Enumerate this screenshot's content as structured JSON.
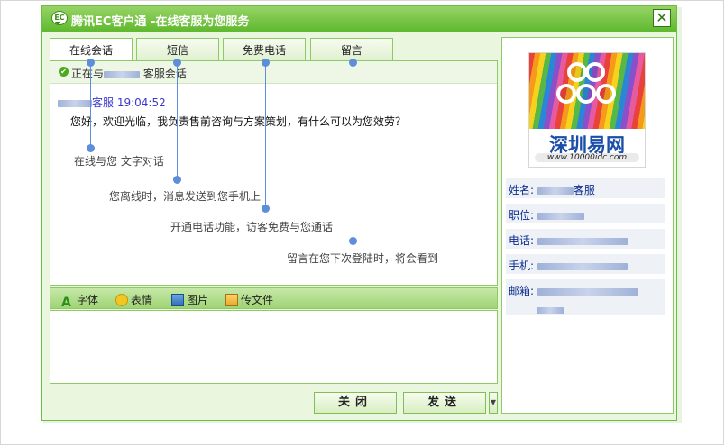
{
  "window": {
    "title": "腾讯EC客户通 -在线客服为您服务",
    "logo_text": "EC",
    "close_symbol": "✕"
  },
  "tabs": [
    {
      "label": "在线会话",
      "active": true
    },
    {
      "label": "短信",
      "active": false
    },
    {
      "label": "免费电话",
      "active": false
    },
    {
      "label": "留言",
      "active": false
    }
  ],
  "chat": {
    "status_prefix": "正在与",
    "status_suffix": "客服会话",
    "sender_suffix": "客服",
    "time": "19:04:52",
    "message": "您好，欢迎光临，我负责售前咨询与方案策划，有什么可以为您效劳？"
  },
  "annotations": {
    "chat": "在线与您 文字对话",
    "sms": "您离线时，消息发送到您手机上",
    "phone": "开通电话功能，访客免费与您通话",
    "message": "留言在您下次登陆时，将会看到"
  },
  "toolbar": {
    "font": "字体",
    "emoji": "表情",
    "image": "图片",
    "file": "传文件",
    "font_icon_char": "A"
  },
  "buttons": {
    "close": "关闭",
    "send": "发送",
    "more_arrow": "▼"
  },
  "sidebar": {
    "logo_name": "深圳易网",
    "logo_url": "www.10000idc.com",
    "fields": [
      {
        "label": "姓名:",
        "value": "客服"
      },
      {
        "label": "职位:",
        "value": ""
      },
      {
        "label": "电话:",
        "value": ""
      },
      {
        "label": "手机:",
        "value": ""
      },
      {
        "label": "邮箱:",
        "value": ""
      }
    ]
  },
  "colors": {
    "accent": "#5fb92e",
    "link_blue": "#5d8edc",
    "label_blue": "#0b2b8c"
  }
}
